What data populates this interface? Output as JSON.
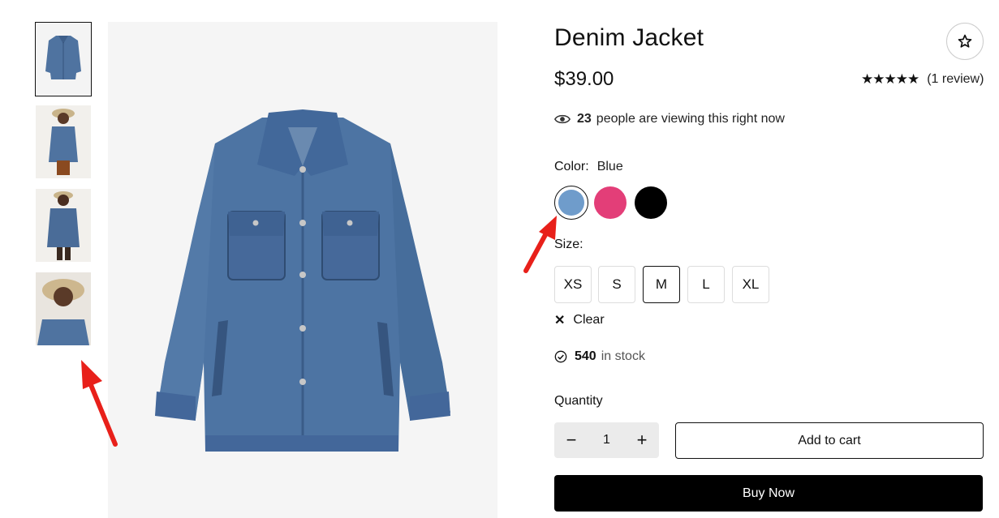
{
  "product": {
    "title": "Denim Jacket",
    "price": "$39.00",
    "rating_stars": "★★★★★",
    "rating_value": 5,
    "reviews_text": "(1 review)"
  },
  "viewing": {
    "count": "23",
    "text": "people are viewing this right now"
  },
  "color": {
    "label": "Color:",
    "selected": "Blue",
    "options": [
      {
        "name": "Blue",
        "hex": "#6f9ccb"
      },
      {
        "name": "Pink",
        "hex": "#e33e78"
      },
      {
        "name": "Black",
        "hex": "#000000"
      }
    ]
  },
  "size": {
    "label": "Size:",
    "options": [
      "XS",
      "S",
      "M",
      "L",
      "XL"
    ],
    "selected": "M"
  },
  "clear_label": "Clear",
  "stock": {
    "count": "540",
    "text": "in stock"
  },
  "quantity": {
    "label": "Quantity",
    "value": "1",
    "minus": "−",
    "plus": "+"
  },
  "actions": {
    "add_to_cart": "Add to cart",
    "buy_now": "Buy Now"
  },
  "icons": {
    "wishlist": "star-outline-icon",
    "viewing": "eye-icon",
    "stock": "check-circle-icon",
    "clear": "close-icon"
  },
  "annotations": {
    "arrow_color": "#e8201a"
  }
}
